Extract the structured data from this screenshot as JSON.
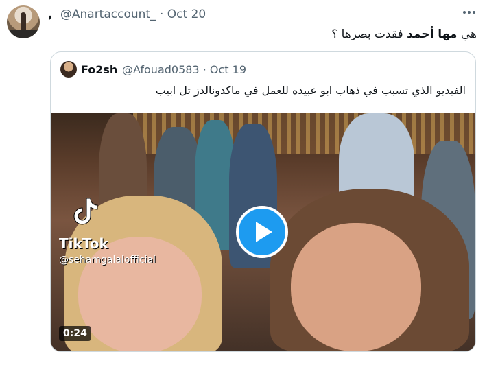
{
  "tweet": {
    "display_name": ",",
    "handle": "@Anartaccount_",
    "separator": "·",
    "date": "Oct 20",
    "text_prefix": "هي ",
    "text_bold": "مها أحمد",
    "text_suffix": " فقدت بصرها ؟"
  },
  "quote": {
    "name": "Fo2sh",
    "handle": "@Afouad0583",
    "separator": "·",
    "date": "Oct 19",
    "text": "الفيديو الذي تسبب في ذهاب ابو عبيده للعمل في ماكدونالدز تل ابيب",
    "video": {
      "watermark_brand": "TikTok",
      "watermark_handle": "@sehamgalalofficial",
      "duration": "0:24"
    }
  },
  "actions": {
    "reply_count": "",
    "retweet_count": "",
    "like_count": "",
    "views_count": ""
  },
  "icons": [
    "more-icon",
    "play-icon",
    "tiktok-logo-icon"
  ],
  "colors": {
    "accent": "#1d9bf0",
    "muted": "#536471",
    "border": "#cfd9de"
  }
}
